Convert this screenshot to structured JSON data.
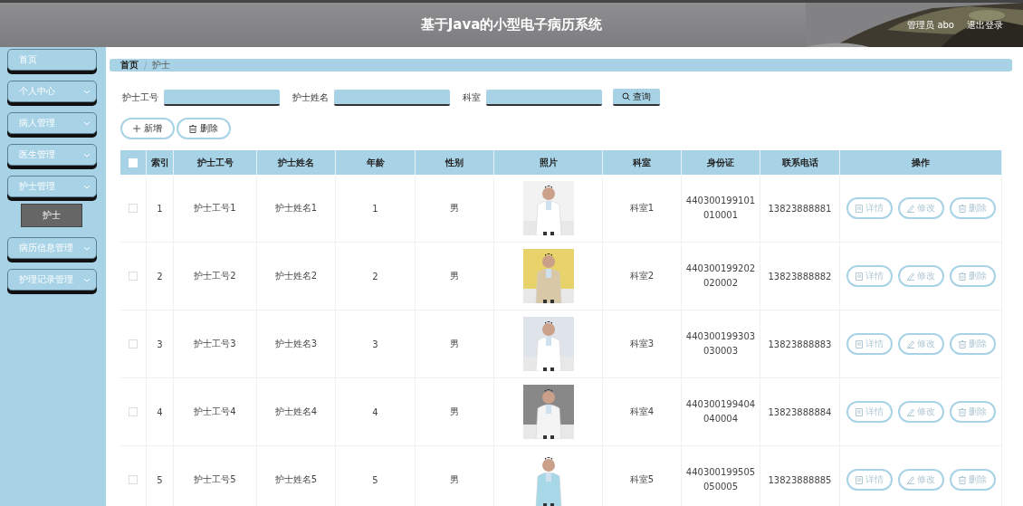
{
  "header": {
    "title": "基于Java的小型电子病历系统",
    "user": "管理员 abo",
    "logout": "退出登录"
  },
  "sidebar": {
    "items": [
      {
        "label": "首页",
        "expandable": false
      },
      {
        "label": "个人中心",
        "expandable": true
      },
      {
        "label": "病人管理",
        "expandable": true
      },
      {
        "label": "医生管理",
        "expandable": true
      },
      {
        "label": "护士管理",
        "expandable": true,
        "children": [
          {
            "label": "护士",
            "selected": true
          }
        ]
      },
      {
        "label": "病历信息管理",
        "expandable": true
      },
      {
        "label": "护理记录管理",
        "expandable": true
      }
    ]
  },
  "breadcrumb": {
    "items": [
      "首页",
      "护士"
    ],
    "separator": "/"
  },
  "search": {
    "fields": [
      {
        "label": "护士工号"
      },
      {
        "label": "护士姓名"
      },
      {
        "label": "科室"
      }
    ],
    "button": "查询"
  },
  "actions": [
    {
      "kind": "add",
      "label": "新增"
    },
    {
      "kind": "delete",
      "label": "删除"
    }
  ],
  "table": {
    "all_checked": false,
    "columns": [
      "索引",
      "护士工号",
      "护士姓名",
      "年龄",
      "性别",
      "照片",
      "科室",
      "身份证",
      "联系电话",
      "操作"
    ],
    "rows": [
      {
        "checked": false,
        "index": "1",
        "no": "护士工号1",
        "name": "护士姓名1",
        "age": "1",
        "sex": "男",
        "dept": "科室1",
        "id": "440300199101010001",
        "phone": "13823888881",
        "actions": [
          {
            "kind": "detail",
            "label": "详情"
          },
          {
            "kind": "edit",
            "label": "修改"
          },
          {
            "kind": "delete",
            "label": "删除"
          }
        ]
      },
      {
        "checked": false,
        "index": "2",
        "no": "护士工号2",
        "name": "护士姓名2",
        "age": "2",
        "sex": "男",
        "dept": "科室2",
        "id": "440300199202020002",
        "phone": "13823888882",
        "actions": [
          {
            "kind": "detail",
            "label": "详情"
          },
          {
            "kind": "edit",
            "label": "修改"
          },
          {
            "kind": "delete",
            "label": "删除"
          }
        ]
      },
      {
        "checked": false,
        "index": "3",
        "no": "护士工号3",
        "name": "护士姓名3",
        "age": "3",
        "sex": "男",
        "dept": "科室3",
        "id": "440300199303030003",
        "phone": "13823888883",
        "actions": [
          {
            "kind": "detail",
            "label": "详情"
          },
          {
            "kind": "edit",
            "label": "修改"
          },
          {
            "kind": "delete",
            "label": "删除"
          }
        ]
      },
      {
        "checked": false,
        "index": "4",
        "no": "护士工号4",
        "name": "护士姓名4",
        "age": "4",
        "sex": "男",
        "dept": "科室4",
        "id": "440300199404040004",
        "phone": "13823888884",
        "actions": [
          {
            "kind": "detail",
            "label": "详情"
          },
          {
            "kind": "edit",
            "label": "修改"
          },
          {
            "kind": "delete",
            "label": "删除"
          }
        ]
      },
      {
        "checked": false,
        "index": "5",
        "no": "护士工号5",
        "name": "护士姓名5",
        "age": "5",
        "sex": "男",
        "dept": "科室5",
        "id": "440300199505050005",
        "phone": "13823888885",
        "actions": [
          {
            "kind": "detail",
            "label": "详情"
          },
          {
            "kind": "edit",
            "label": "修改"
          },
          {
            "kind": "delete",
            "label": "删除"
          }
        ]
      }
    ]
  }
}
